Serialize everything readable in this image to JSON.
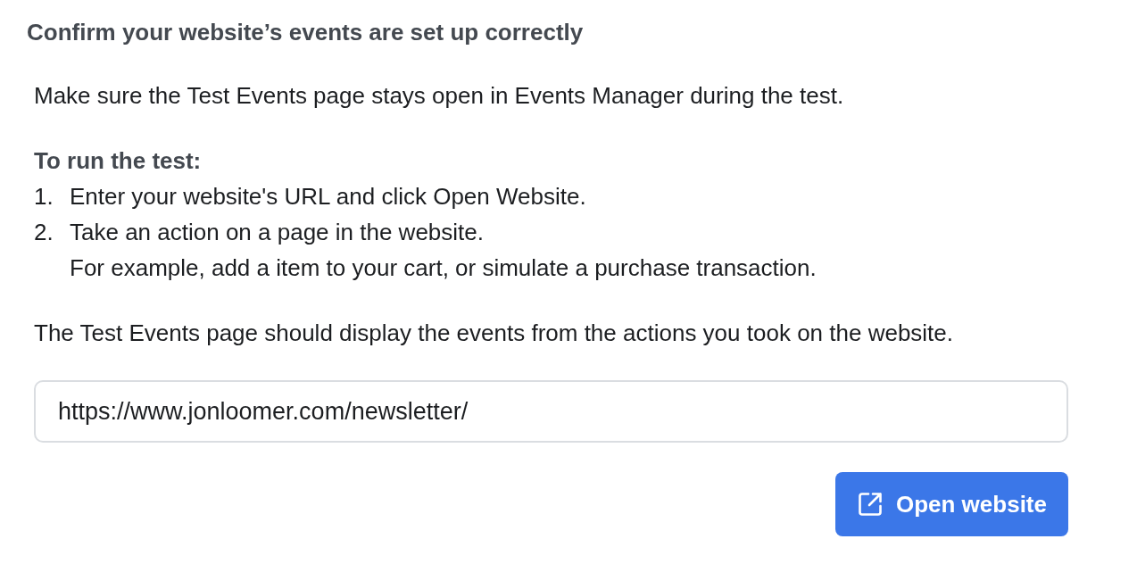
{
  "heading": "Confirm your website’s events are set up correctly",
  "intro": "Make sure the Test Events page stays open in Events Manager during the test.",
  "steps_title": "To run the test:",
  "steps": [
    {
      "number": "1.",
      "text": "Enter your website's URL and click Open Website."
    },
    {
      "number": "2.",
      "text": "Take an action on a page in the website.",
      "detail": "For example, add a item to your cart, or simulate a purchase transaction."
    }
  ],
  "outro": "The Test Events page should display the events from the actions you took on the website.",
  "url_field": {
    "value": "https://www.jonloomer.com/newsletter/"
  },
  "button": {
    "label": "Open website"
  }
}
